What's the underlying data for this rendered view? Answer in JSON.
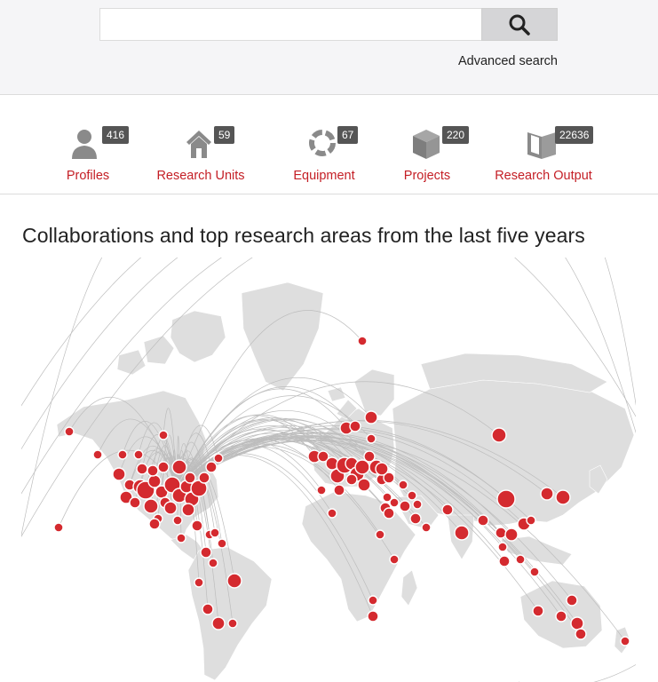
{
  "search": {
    "placeholder": "",
    "value": "",
    "advanced_label": "Advanced search"
  },
  "stats": [
    {
      "label": "Profiles",
      "count": "416",
      "icon": "person-icon"
    },
    {
      "label": "Research Units",
      "count": "59",
      "icon": "house-icon"
    },
    {
      "label": "Equipment",
      "count": "67",
      "icon": "ring-icon"
    },
    {
      "label": "Projects",
      "count": "220",
      "icon": "box-icon"
    },
    {
      "label": "Research Output",
      "count": "22636",
      "icon": "book-icon"
    }
  ],
  "section": {
    "heading": "Collaborations and top research areas from the last five years"
  },
  "colors": {
    "accent": "#c41e25",
    "dot": "#d42a2f",
    "badge": "#555555",
    "land": "#dedede",
    "arc": "#bdbdbd"
  }
}
